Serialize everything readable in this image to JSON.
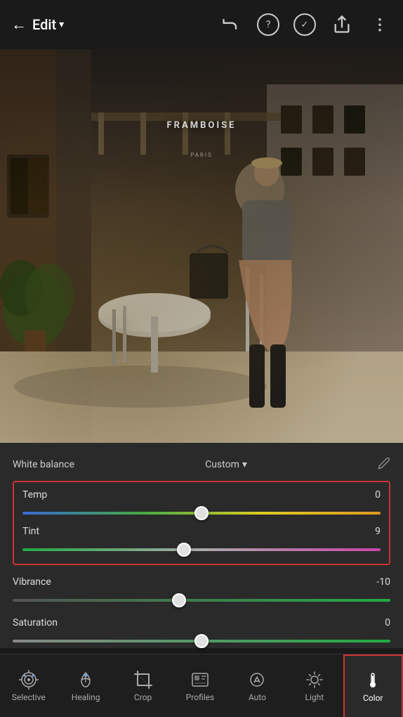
{
  "header": {
    "back_label": "←",
    "title": "Edit",
    "dropdown_icon": "▾",
    "undo_icon": "↩",
    "help_icon": "?",
    "check_icon": "✓",
    "share_icon": "⤴",
    "more_icon": "⋮"
  },
  "photo": {
    "sign_text": "FRAMBOISE",
    "sign_sub": "PARIS"
  },
  "controls": {
    "white_balance_label": "White balance",
    "custom_label": "Custom",
    "dropdown_icon": "▾",
    "pencil_icon": "✏"
  },
  "sliders": {
    "temp": {
      "label": "Temp",
      "value": "0",
      "percent": 50
    },
    "tint": {
      "label": "Tint",
      "value": "9",
      "percent": 45
    },
    "vibrance": {
      "label": "Vibrance",
      "value": "-10",
      "percent": 44
    },
    "saturation": {
      "label": "Saturation",
      "value": "0",
      "percent": 50
    }
  },
  "toolbar": {
    "items": [
      {
        "id": "selective",
        "label": "Selective",
        "icon": "selective"
      },
      {
        "id": "healing",
        "label": "Healing",
        "icon": "healing"
      },
      {
        "id": "crop",
        "label": "Crop",
        "icon": "crop"
      },
      {
        "id": "profiles",
        "label": "Profiles",
        "icon": "profiles"
      },
      {
        "id": "auto",
        "label": "Auto",
        "icon": "auto"
      },
      {
        "id": "light",
        "label": "Light",
        "icon": "light"
      },
      {
        "id": "color",
        "label": "Color",
        "icon": "color",
        "active": true
      }
    ]
  }
}
